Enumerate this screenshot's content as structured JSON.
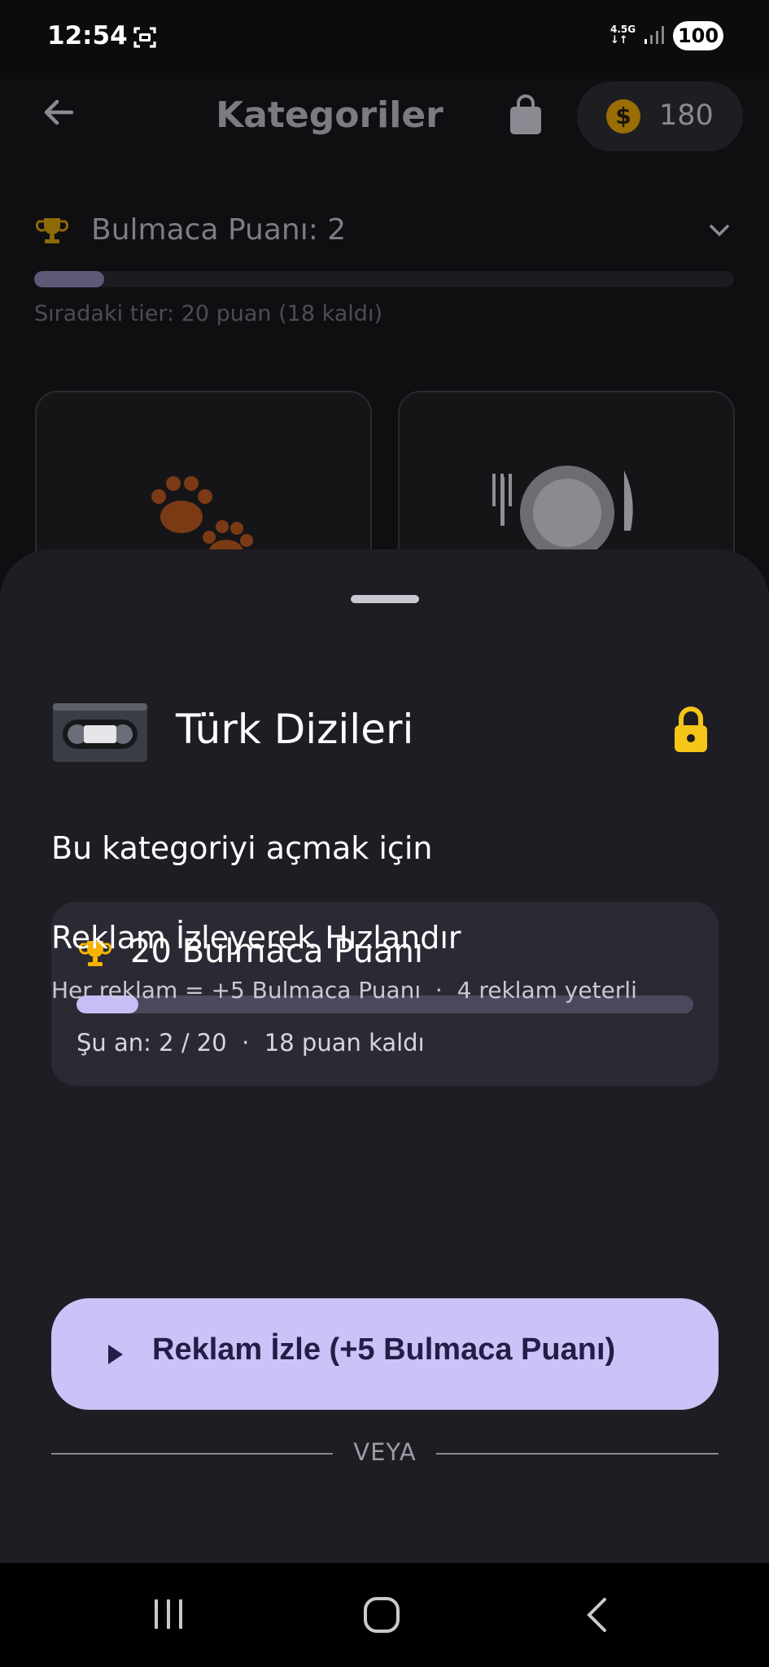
{
  "status_bar": {
    "time": "12:54",
    "network": "4.5G",
    "battery": "100"
  },
  "header": {
    "title": "Kategoriler",
    "coins": "180"
  },
  "puzzle_score": {
    "label": "Bulmaca Puanı: 2",
    "progress": 0.1,
    "next_tier": "Sıradaki tier: 20 puan (18 kaldı)"
  },
  "category_cards": [
    {
      "icon": "paw-prints-icon"
    },
    {
      "icon": "plate-cutlery-icon"
    }
  ],
  "sheet": {
    "category_icon": "videocassette-icon",
    "category_title": "Türk Dizileri",
    "unlock_label": "Bu kategoriyi açmak için",
    "requirement": {
      "title": "20 Bulmaca Puanı",
      "progress": 0.1,
      "status": "Şu an: 2 / 20  ·  18 puan kaldı"
    },
    "divider": "VEYA",
    "ad": {
      "title": "Reklam İzleyerek Hızlandır",
      "subtitle": "Her reklam = +5 Bulmaca Puanı  ·  4 reklam yeterli",
      "button_label": "Reklam İzle (+5 Bulmaca Puanı)"
    }
  },
  "colors": {
    "accent": "#ccc2f8",
    "gold": "#f5c518",
    "sheet_bg": "#1e1d24"
  }
}
